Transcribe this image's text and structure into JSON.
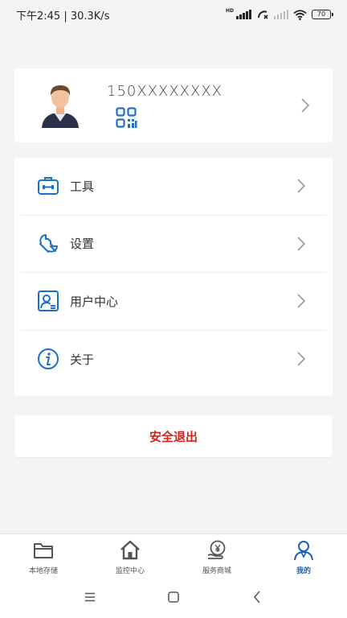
{
  "status_bar": {
    "left_text": "下午2:45 | 30.3K/s",
    "battery": "70",
    "hd_label": "HD"
  },
  "profile": {
    "phone": "150XXXXXXXX"
  },
  "menu": {
    "items": [
      {
        "label": "工具",
        "icon": "toolbox-icon"
      },
      {
        "label": "设置",
        "icon": "wrench-icon"
      },
      {
        "label": "用户中心",
        "icon": "user-card-icon"
      },
      {
        "label": "关于",
        "icon": "info-icon"
      }
    ]
  },
  "logout": {
    "label": "安全退出",
    "color": "#d9211d"
  },
  "tab_bar": {
    "tabs": [
      {
        "label": "本地存储",
        "icon": "folder-icon",
        "active": false
      },
      {
        "label": "监控中心",
        "icon": "home-icon",
        "active": false
      },
      {
        "label": "服务商城",
        "icon": "yen-hand-icon",
        "active": false
      },
      {
        "label": "我的",
        "icon": "person-icon",
        "active": true
      }
    ]
  },
  "colors": {
    "accent": "#1a5fb4",
    "icon_blue": "#1e6fc8",
    "background": "#f4f4f4"
  }
}
